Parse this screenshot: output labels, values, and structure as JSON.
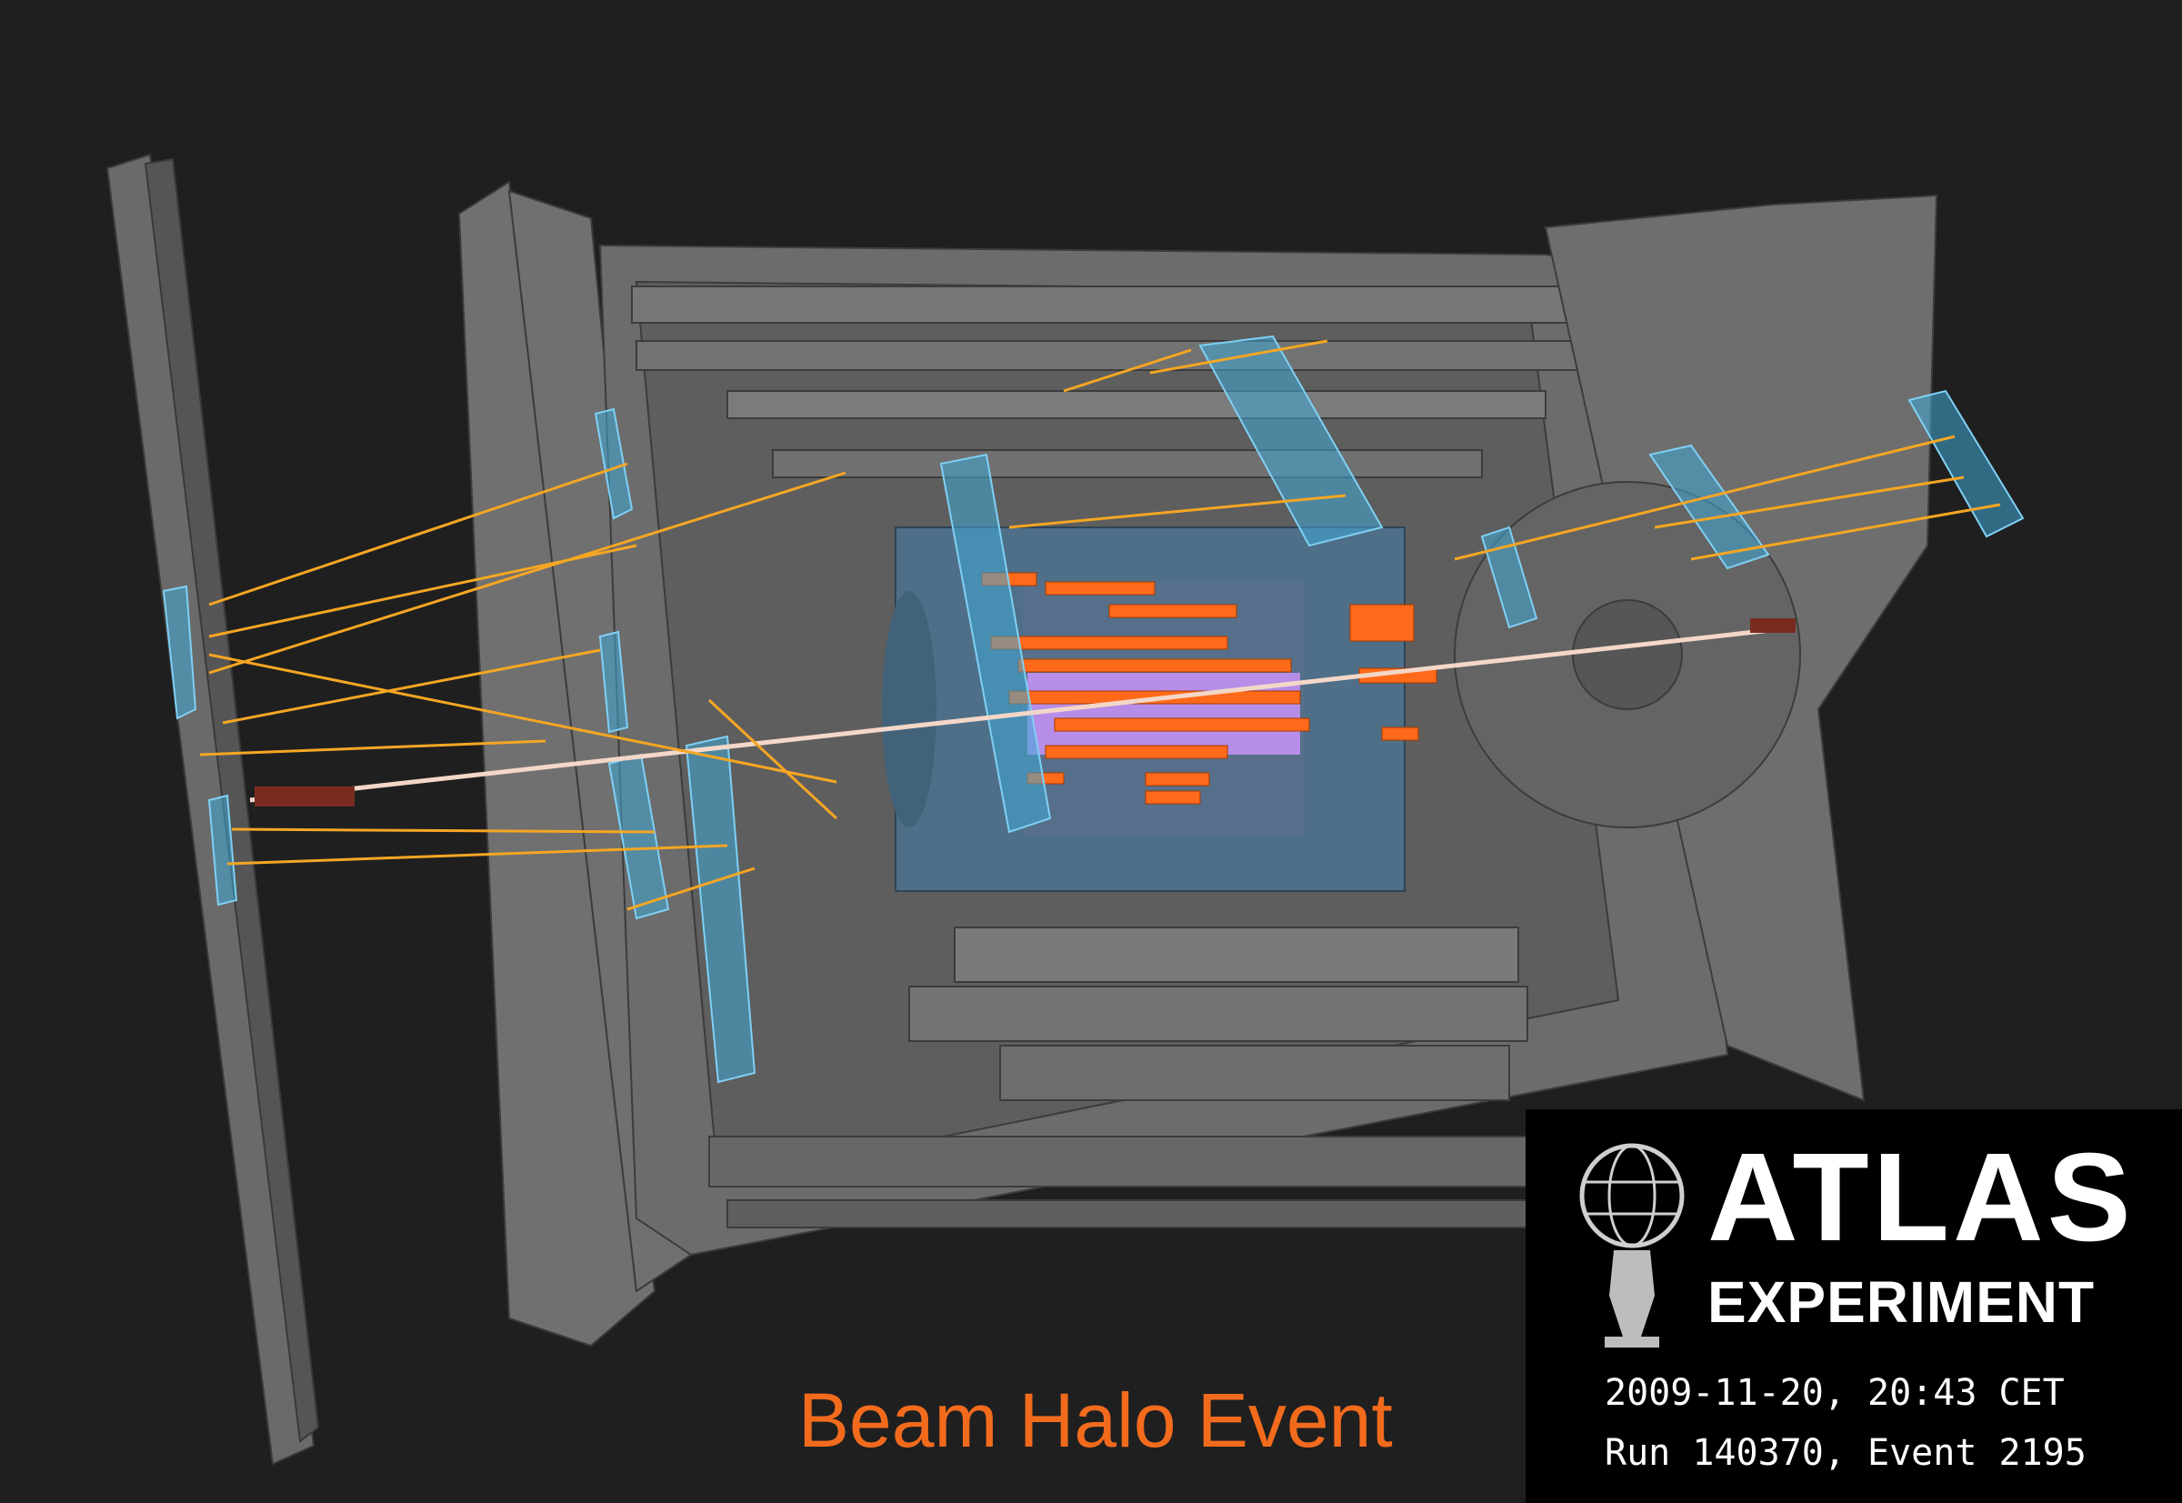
{
  "caption": "Beam Halo Event",
  "logo": {
    "title": "ATLAS",
    "subtitle": "EXPERIMENT",
    "icon": "atlas-figure-globe-icon"
  },
  "event_info": {
    "datetime": "2009-11-20, 20:43 CET",
    "run_event": "Run 140370, Event 2195"
  },
  "colors": {
    "background": "#1f1f1f",
    "detector_gray": "#6f6f6f",
    "muon_chamber_blue": "#3fa7d6",
    "calorimeter_hits": "#ff6a1a",
    "tracks": "#f5a623",
    "inner_detector": "#c49cff",
    "caption": "#f26b1d"
  }
}
